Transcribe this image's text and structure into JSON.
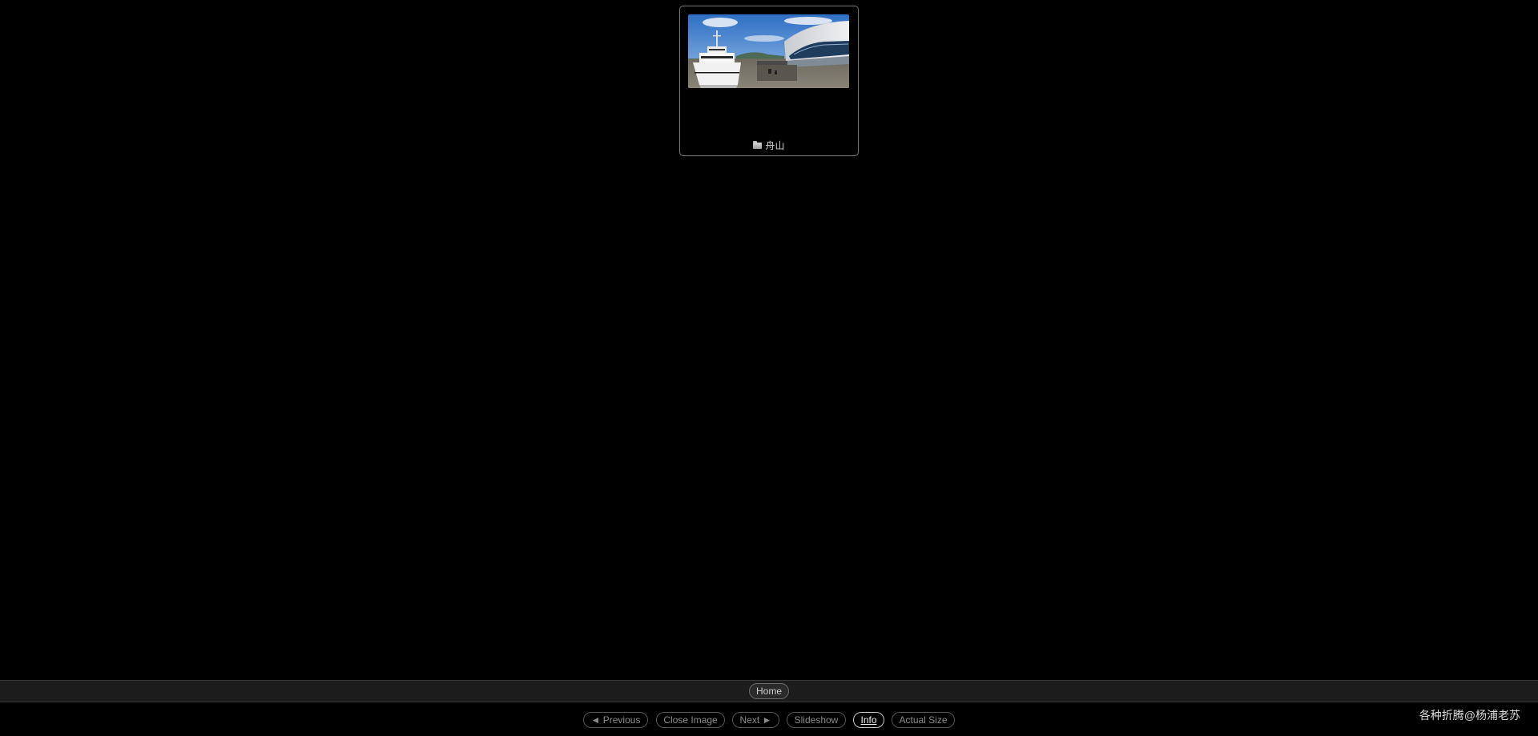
{
  "album": {
    "title": "舟山",
    "icon": "folder-icon"
  },
  "nav": {
    "home_label": "Home"
  },
  "controls": {
    "previous_label": "◄ Previous",
    "close_label": "Close Image",
    "next_label": "Next ►",
    "slideshow_label": "Slideshow",
    "info_label": "Info",
    "actual_size_label": "Actual Size"
  },
  "footer": {
    "site_credit": "各种折腾@杨浦老苏"
  }
}
